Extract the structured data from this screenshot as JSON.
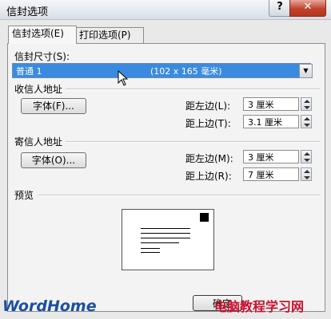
{
  "window": {
    "title": "信封选项",
    "help_label": "?",
    "close_label": "✕"
  },
  "tabs": [
    {
      "label": "信封选项(E)"
    },
    {
      "label": "打印选项(P)"
    }
  ],
  "envelope_size": {
    "label": "信封尺寸(S):",
    "selected": "普通 1",
    "dimensions": "(102 x 165 毫米)"
  },
  "recipient": {
    "group_label": "收信人地址",
    "font_button": "字体(F)...",
    "left_label": "距左边(L):",
    "left_value": "3 厘米",
    "top_label": "距上边(T):",
    "top_value": "3.1 厘米"
  },
  "sender": {
    "group_label": "寄信人地址",
    "font_button": "字体(O)...",
    "left_label": "距左边(M):",
    "left_value": "3 厘米",
    "top_label": "距上边(R):",
    "top_value": "7 厘米"
  },
  "preview": {
    "label": "预览"
  },
  "footer": {
    "ok_label": "确定",
    "logo": "WordHome",
    "watermark": "电脑教程学习网"
  }
}
